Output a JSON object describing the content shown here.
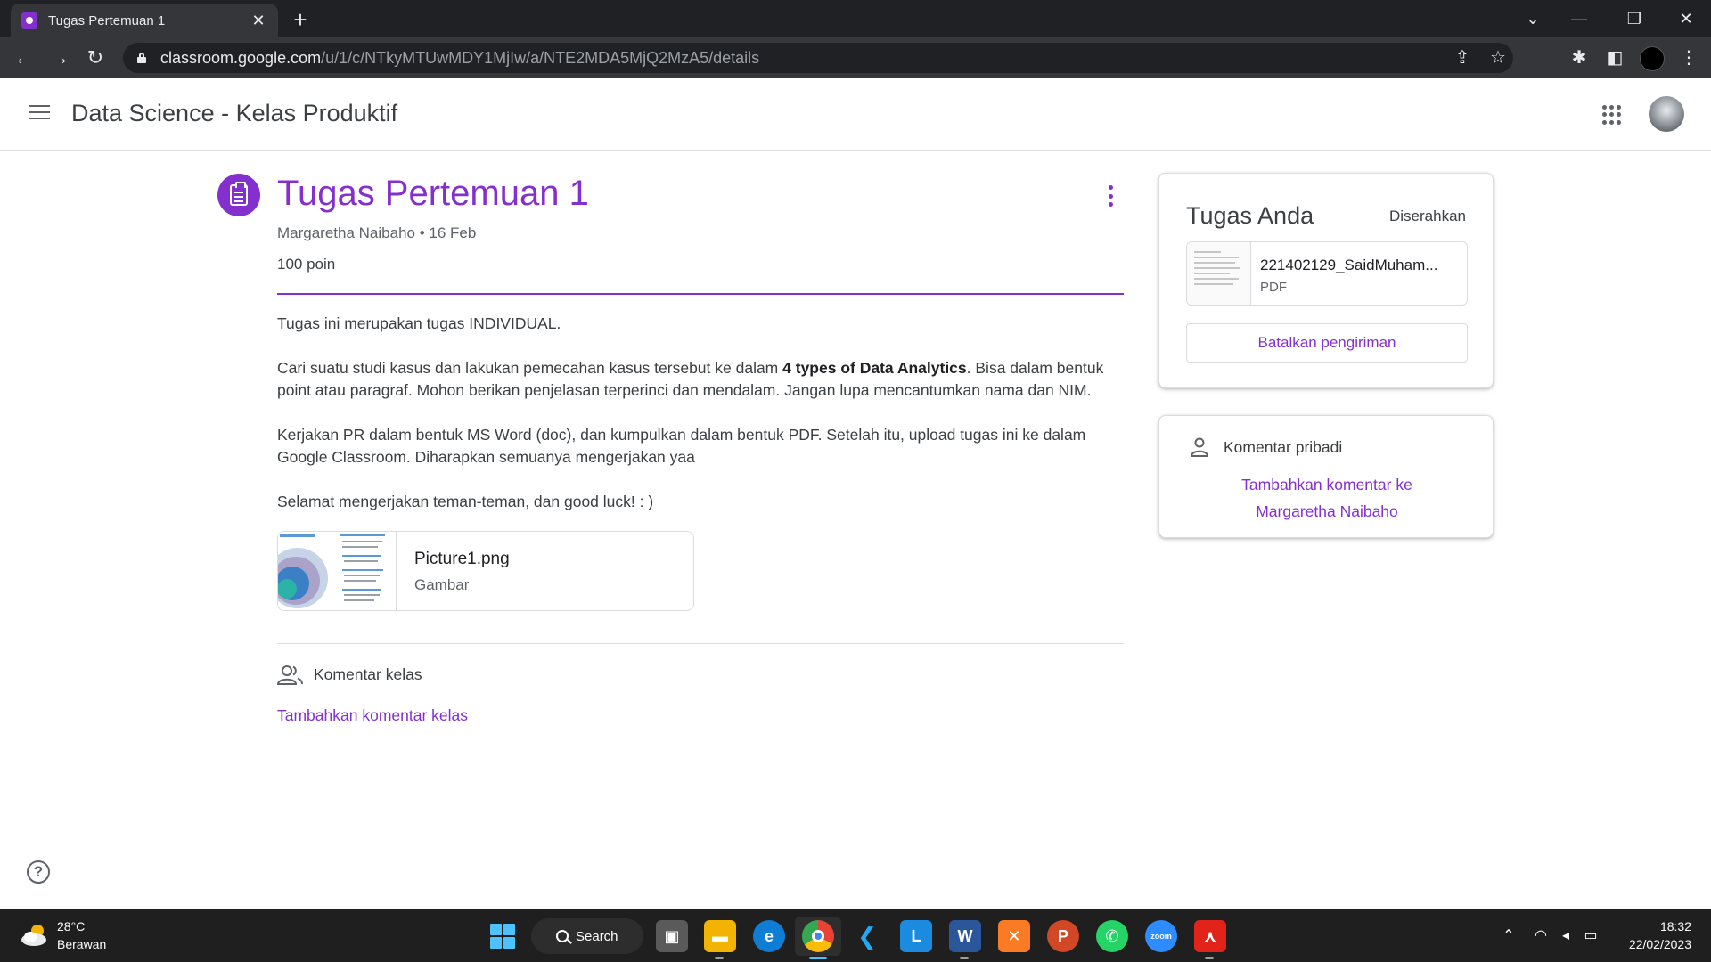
{
  "browser": {
    "tab_title": "Tugas Pertemuan 1",
    "url_host": "classroom.google.com",
    "url_path": "/u/1/c/NTkyMTUwMDY1MjIw/a/NTE2MDA5MjQ2MzA5/details"
  },
  "header": {
    "class_title": "Data Science - Kelas Produktif"
  },
  "assignment": {
    "title": "Tugas Pertemuan 1",
    "meta": "Margaretha Naibaho • 16 Feb",
    "points": "100 poin",
    "desc_p1": "Tugas ini merupakan tugas INDIVIDUAL.",
    "desc_p2_a": "Cari suatu studi kasus dan lakukan pemecahan kasus tersebut ke dalam ",
    "desc_p2_bold": "4 types of Data Analytics",
    "desc_p2_b": ". Bisa dalam bentuk point atau paragraf. Mohon berikan penjelasan terperinci dan mendalam. Jangan lupa mencantumkan nama dan NIM.",
    "desc_p3": "Kerjakan PR dalam bentuk MS Word (doc), dan kumpulkan dalam bentuk PDF. Setelah itu, upload tugas ini ke dalam Google Classroom. Diharapkan semuanya mengerjakan yaa",
    "desc_p4": "Selamat mengerjakan teman-teman, dan good luck! : )",
    "attachment": {
      "name": "Picture1.png",
      "type": "Gambar"
    }
  },
  "class_comments": {
    "label": "Komentar kelas",
    "add_link": "Tambahkan komentar kelas"
  },
  "your_work": {
    "title": "Tugas Anda",
    "status": "Diserahkan",
    "file_name": "221402129_SaidMuham...",
    "file_type": "PDF",
    "unsubmit_label": "Batalkan pengiriman"
  },
  "private_comments": {
    "label": "Komentar pribadi",
    "add_link_line1": "Tambahkan komentar ke",
    "add_link_line2": "Margaretha Naibaho"
  },
  "taskbar": {
    "weather_temp": "28°C",
    "weather_desc": "Berawan",
    "search_label": "Search",
    "time": "18:32",
    "date": "22/02/2023"
  },
  "theme": {
    "accent": "#8430ce",
    "text": "#3c4043",
    "muted": "#5f6368"
  }
}
